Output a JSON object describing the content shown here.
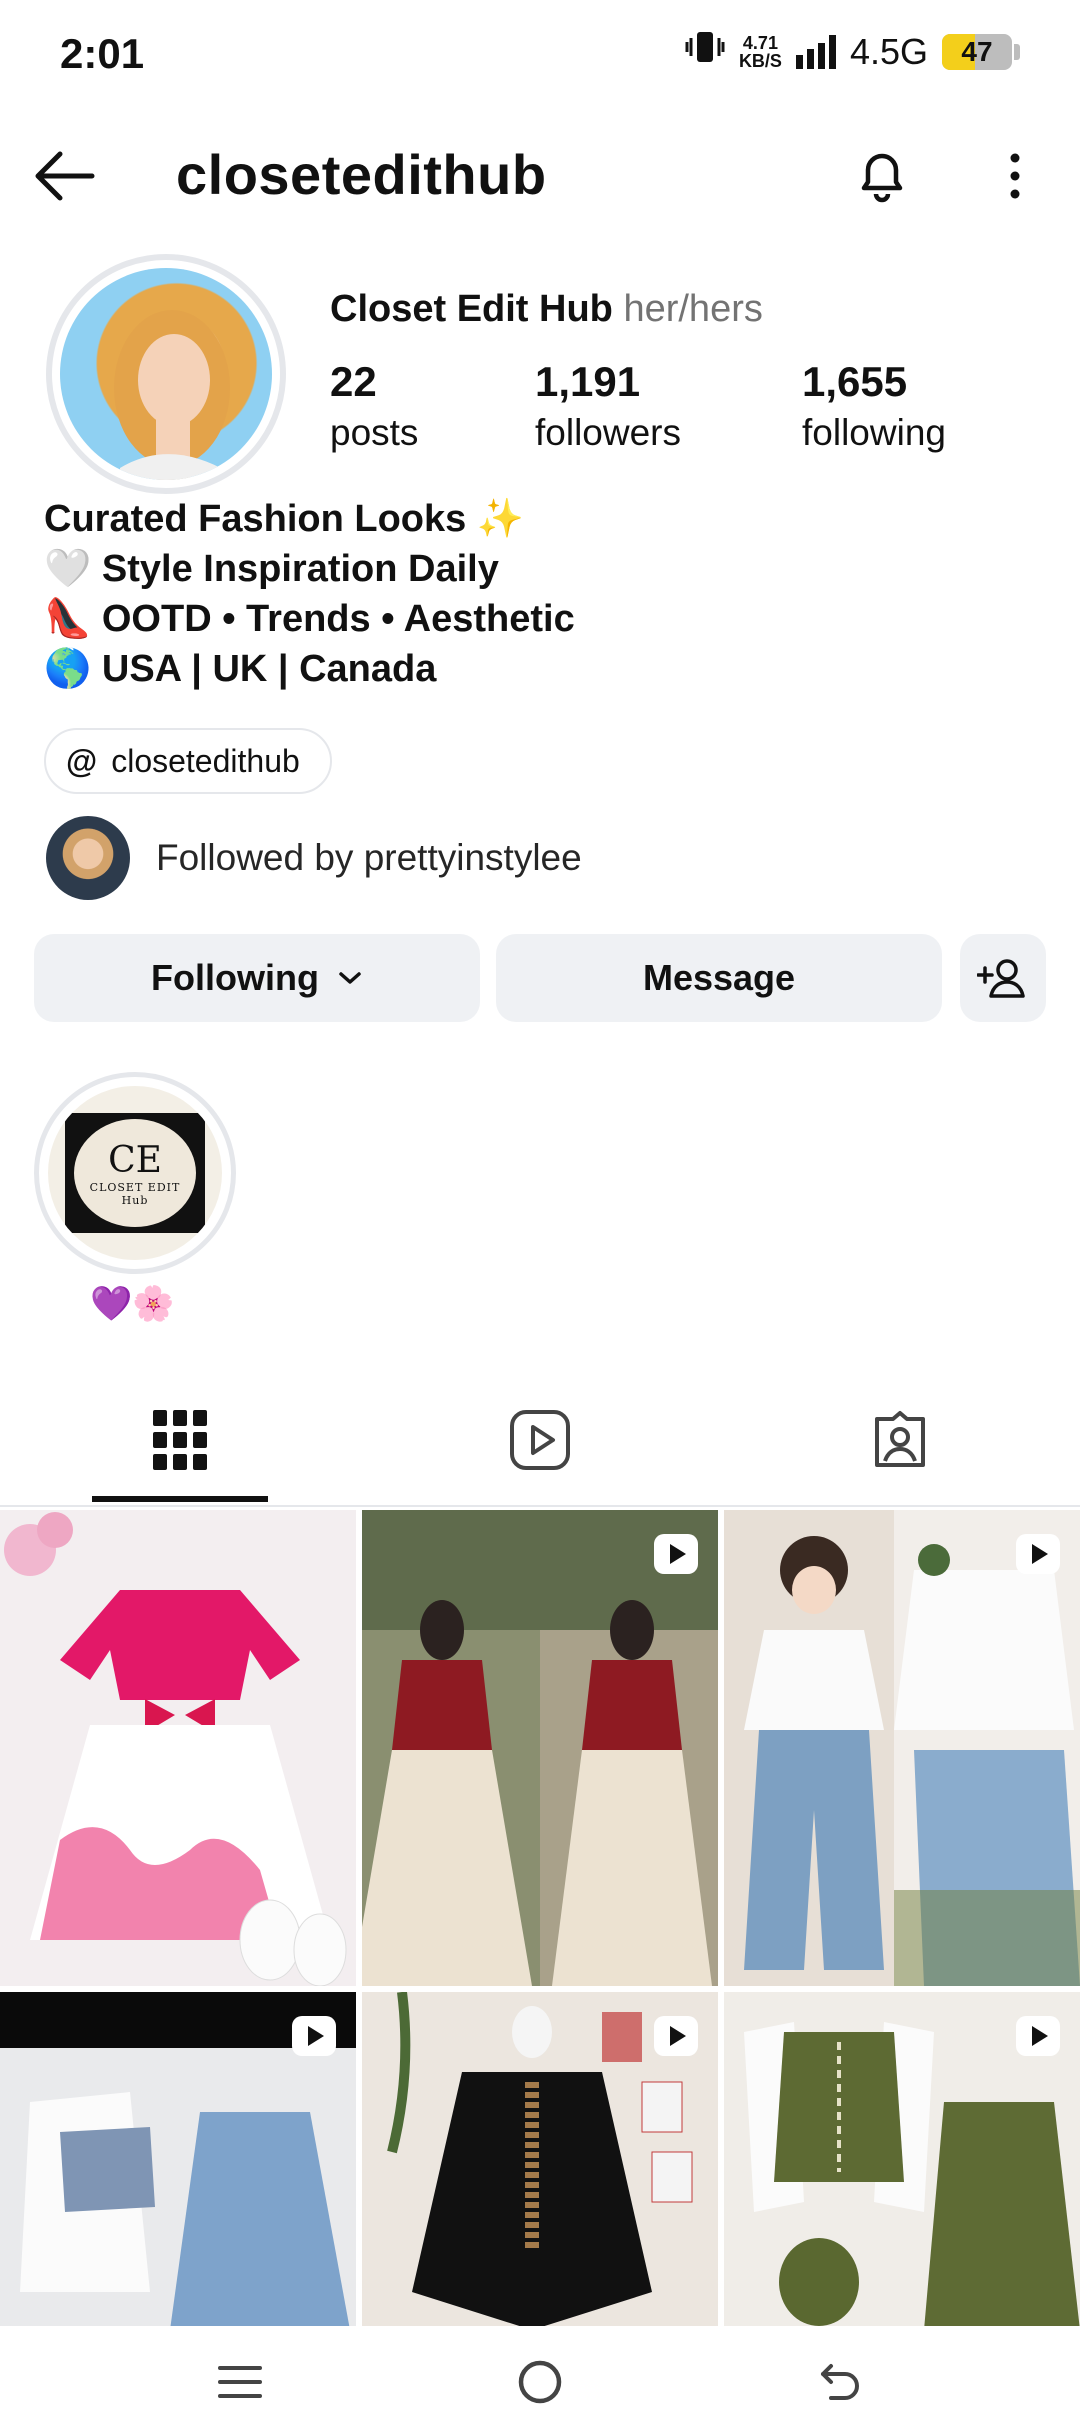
{
  "status_bar": {
    "time": "2:01",
    "net_speed_value": "4.71",
    "net_speed_unit": "KB/S",
    "network": "4.5G",
    "battery": "47",
    "battery_level": 0.47,
    "battery_color": "#f3cf1b"
  },
  "header": {
    "username": "closetedithub",
    "icons": [
      "back-arrow-icon",
      "bell-icon",
      "more-vertical-icon"
    ]
  },
  "profile": {
    "display_name": "Closet Edit Hub",
    "pronouns": "her/hers",
    "stats": [
      {
        "value": "22",
        "label": "posts"
      },
      {
        "value": "1,191",
        "label": "followers"
      },
      {
        "value": "1,655",
        "label": "following"
      }
    ],
    "bio": [
      "Curated Fashion Looks ✨",
      "🤍 Style Inspiration Daily",
      "👠 OOTD • Trends • Aesthetic",
      "🌎 USA | UK | Canada"
    ],
    "threads_icon": "@",
    "threads_handle": "closetedithub",
    "followed_by": "Followed by prettyinstylee"
  },
  "actions": {
    "following": "Following",
    "message": "Message"
  },
  "highlight": {
    "logo_monogram": "CE",
    "logo_text": "CLOSET EDIT",
    "logo_subtext": "Hub",
    "label": "💜🌸"
  },
  "tabs": [
    "grid-icon",
    "reels-icon",
    "tagged-icon"
  ],
  "posts": [
    {
      "type": "photo",
      "bg": "#f3eef0"
    },
    {
      "type": "reel",
      "bg": "#b9a48a"
    },
    {
      "type": "reel",
      "bg": "#e7dfd6"
    },
    {
      "type": "reel",
      "bg": "#e9eaec"
    },
    {
      "type": "reel",
      "bg": "#ece6df"
    },
    {
      "type": "reel",
      "bg": "#f0ede8"
    }
  ],
  "navbar": [
    "menu-icon",
    "home-circle-icon",
    "back-icon"
  ]
}
